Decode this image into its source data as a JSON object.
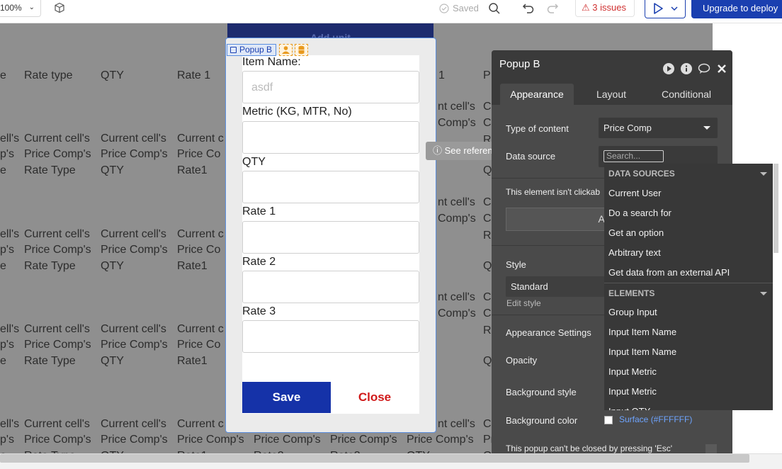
{
  "topbar": {
    "zoom": "100%",
    "saved_label": "Saved",
    "issues_label": "3 issues",
    "upgrade_label": "Upgrade to deploy"
  },
  "canvas": {
    "header_row": [
      "e",
      "Rate type",
      "QTY",
      "Rate 1",
      "1",
      "P"
    ],
    "behind_header_text": "Add unit",
    "cell_lines": [
      "Current cell's",
      "Price Comp's",
      "Rate Type",
      "QTY",
      "Rate1"
    ],
    "truncated_cells": [
      "ell's",
      "p's",
      "e",
      "Current c",
      "Price Co",
      "nt cell's",
      "Comp's",
      "Cu",
      "Cc",
      "R",
      "Q"
    ],
    "bottom_row": [
      "ell's",
      "Current cell's",
      "Current cell's",
      "Current c",
      "nt cell's",
      "Cu"
    ],
    "bottom_row_2": [
      "p's",
      "Price Comp's",
      "Price Comp's",
      "Price Comp's",
      "Price Comp's",
      "Price Comp's",
      "Price Comp's",
      "Price Comp's",
      "Price Comp's",
      "Price Comp's"
    ],
    "bottom_row_3": [
      "e",
      "Rate Type",
      "QTY",
      "Rate1",
      "Rate2",
      "Rate3",
      "QTY",
      "Q"
    ]
  },
  "popup": {
    "tag_label": "Popup B",
    "fields": [
      {
        "label": "Item Name:",
        "value": "asdf"
      },
      {
        "label": "Metric (KG, MTR, No)",
        "value": ""
      },
      {
        "label": "QTY",
        "value": ""
      },
      {
        "label": "Rate 1",
        "value": ""
      },
      {
        "label": "Rate 2",
        "value": ""
      },
      {
        "label": "Rate 3",
        "value": ""
      }
    ],
    "save_label": "Save",
    "close_label": "Close"
  },
  "see_reference_label": "See reference",
  "editor": {
    "title": "Popup B",
    "tabs": [
      "Appearance",
      "Layout",
      "Conditional"
    ],
    "type_of_content_label": "Type of content",
    "type_of_content_value": "Price Comp",
    "data_source_label": "Data source",
    "search_placeholder": "Search...",
    "not_clickable_text": "This element isn't clickab",
    "add_button_label": "Add w",
    "style_label": "Style",
    "style_value": "Standard",
    "edit_style_label": "Edit style",
    "appearance_settings_label": "Appearance Settings",
    "opacity_label": "Opacity",
    "background_style_label": "Background style",
    "background_color_label": "Background color",
    "background_color_value": "Surface (#FFFFFF)",
    "esc_text": "This popup can't be closed by pressing 'Esc'"
  },
  "dropdown": {
    "section_1": "DATA SOURCES",
    "items_1": [
      "Current User",
      "Do a search for",
      "Get an option",
      "Arbitrary text",
      "Get data from an external API"
    ],
    "section_2": "ELEMENTS",
    "items_2": [
      "Group Input",
      "Input Item Name",
      "Input Item Name",
      "Input Metric",
      "Input Metric",
      "Input QTY"
    ]
  },
  "colors": {
    "brand_blue": "#1a3fb0",
    "issues_red": "#d03030",
    "close_red": "#d01a1a",
    "editor_bg": "#4a4a4a",
    "canvas_bg": "#8f8f8f"
  }
}
